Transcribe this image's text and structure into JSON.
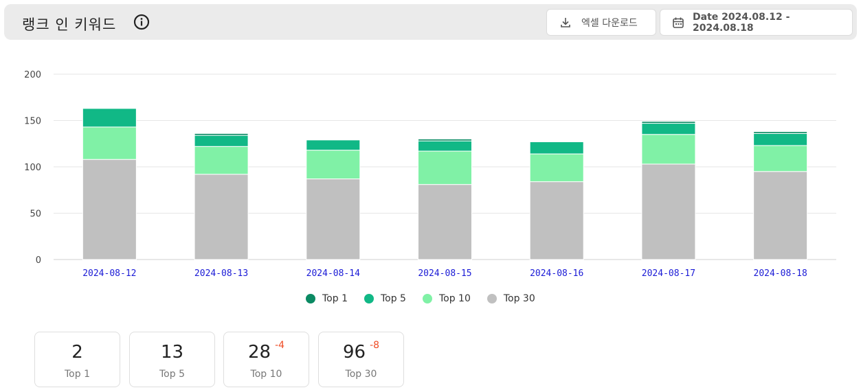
{
  "header": {
    "title": "랭크 인 키워드",
    "excel_button": "엑셀 다운로드",
    "date_button": "Date 2024.08.12 - 2024.08.18"
  },
  "colors": {
    "top1": "#0b8a63",
    "top5": "#11b886",
    "top10": "#80f1a6",
    "top30": "#c0c0c0",
    "date_label": "#1a1ad6",
    "delta": "#ef4b24"
  },
  "chart_data": {
    "type": "bar",
    "stacked": true,
    "categories": [
      "2024-08-12",
      "2024-08-13",
      "2024-08-14",
      "2024-08-15",
      "2024-08-16",
      "2024-08-17",
      "2024-08-18"
    ],
    "series": [
      {
        "name": "Top 30",
        "values": [
          108,
          92,
          87,
          81,
          84,
          103,
          95
        ]
      },
      {
        "name": "Top 10",
        "values": [
          35,
          30,
          31,
          36,
          30,
          32,
          28
        ]
      },
      {
        "name": "Top 5",
        "values": [
          20,
          12,
          11,
          11,
          13,
          12,
          13
        ]
      },
      {
        "name": "Top 1",
        "values": [
          0,
          2,
          0,
          2,
          0,
          2,
          2
        ]
      }
    ],
    "ylim": [
      0,
      200
    ],
    "yticks": [
      0,
      50,
      100,
      150,
      200
    ],
    "grid": true,
    "legend": "bottom-center"
  },
  "legend": [
    {
      "label": "Top 1",
      "color": "#0b8a63"
    },
    {
      "label": "Top 5",
      "color": "#11b886"
    },
    {
      "label": "Top 10",
      "color": "#80f1a6"
    },
    {
      "label": "Top 30",
      "color": "#c0c0c0"
    }
  ],
  "summary": [
    {
      "value": "2",
      "delta": "",
      "label": "Top 1"
    },
    {
      "value": "13",
      "delta": "",
      "label": "Top 5"
    },
    {
      "value": "28",
      "delta": "-4",
      "label": "Top 10"
    },
    {
      "value": "96",
      "delta": "-8",
      "label": "Top 30"
    }
  ]
}
